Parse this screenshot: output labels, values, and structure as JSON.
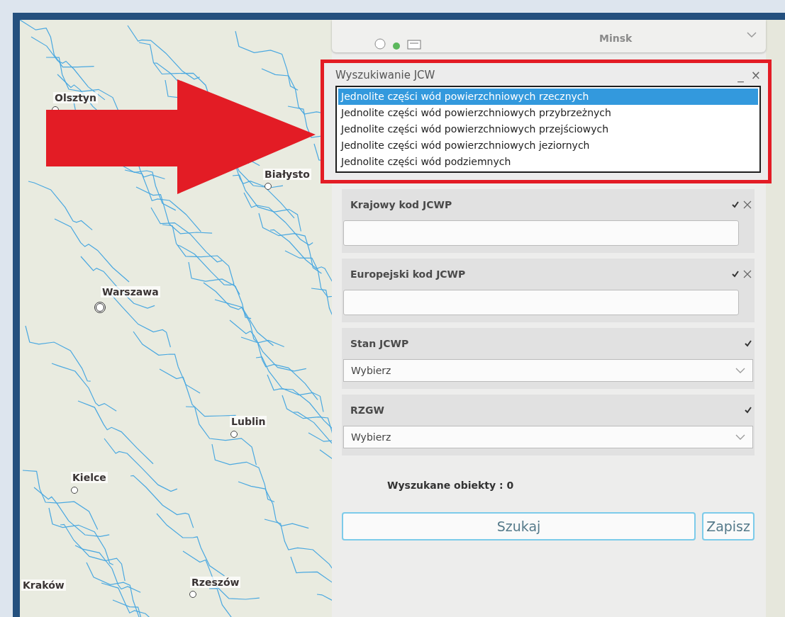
{
  "map": {
    "labels": [
      {
        "text": "Olsztyn",
        "kind": "town"
      },
      {
        "text": "Białysto",
        "kind": "town"
      },
      {
        "text": "Warszawa",
        "kind": "capital"
      },
      {
        "text": "Lublin",
        "kind": "town"
      },
      {
        "text": "Kielce",
        "kind": "town"
      },
      {
        "text": "Kraków",
        "kind": "label"
      },
      {
        "text": "Rzeszów",
        "kind": "town"
      },
      {
        "text": "Minsk",
        "kind": "faint"
      }
    ]
  },
  "layer_card": {
    "expanded": false
  },
  "widget": {
    "title": "Wyszukiwanie JCW",
    "minimize": "_",
    "close": "×",
    "water_types": [
      {
        "label": "Jednolite części wód powierzchniowych rzecznych",
        "selected": true
      },
      {
        "label": "Jednolite części wód powierzchniowych przybrzeżnych",
        "selected": false
      },
      {
        "label": "Jednolite części wód powierzchniowych przejściowych",
        "selected": false
      },
      {
        "label": "Jednolite części wód powierzchniowych jeziornych",
        "selected": false
      },
      {
        "label": "Jednolite części wód podziemnych",
        "selected": false
      }
    ]
  },
  "filters": [
    {
      "kind": "text",
      "label": "Krajowy kod JCWP",
      "removable": true
    },
    {
      "kind": "text",
      "label": "Europejski kod JCWP",
      "removable": true
    },
    {
      "kind": "select",
      "label": "Stan JCWP",
      "value": "Wybierz",
      "removable": false
    },
    {
      "kind": "select",
      "label": "RZGW",
      "value": "Wybierz",
      "removable": false
    }
  ],
  "result": "Wyszukane obiekty : 0",
  "buttons": [
    {
      "label": "Szukaj",
      "kind": "primary"
    },
    {
      "label": "Zapisz",
      "kind": "secondary"
    }
  ]
}
